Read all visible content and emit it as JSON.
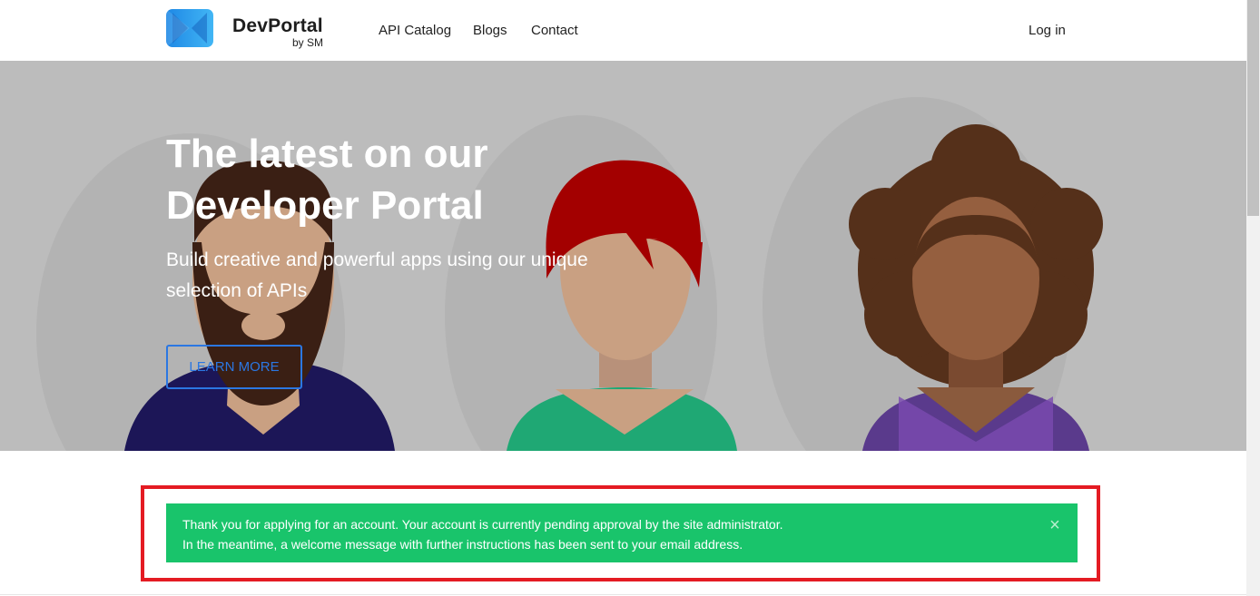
{
  "brand": {
    "name": "DevPortal",
    "sub": "by SM",
    "logo_icon": "bowtie-logo-icon"
  },
  "nav": {
    "api_catalog": "API Catalog",
    "blogs": "Blogs",
    "contact": "Contact",
    "login": "Log in"
  },
  "hero": {
    "title": "The latest on our\nDeveloper Portal",
    "subtitle": "Build creative and powerful apps using our unique\nselection of APIs",
    "cta_label": "LEARN MORE"
  },
  "alert": {
    "line1": "Thank you for applying for an account. Your account is currently pending approval by the site administrator.",
    "line2": "In the meantime, a welcome message with further instructions has been sent to your email address.",
    "close_label": "×",
    "background": "#19c46b"
  },
  "colors": {
    "accent": "#2b77e2",
    "highlight": "#e41b23",
    "hero_bg": "#bcbcbc"
  }
}
